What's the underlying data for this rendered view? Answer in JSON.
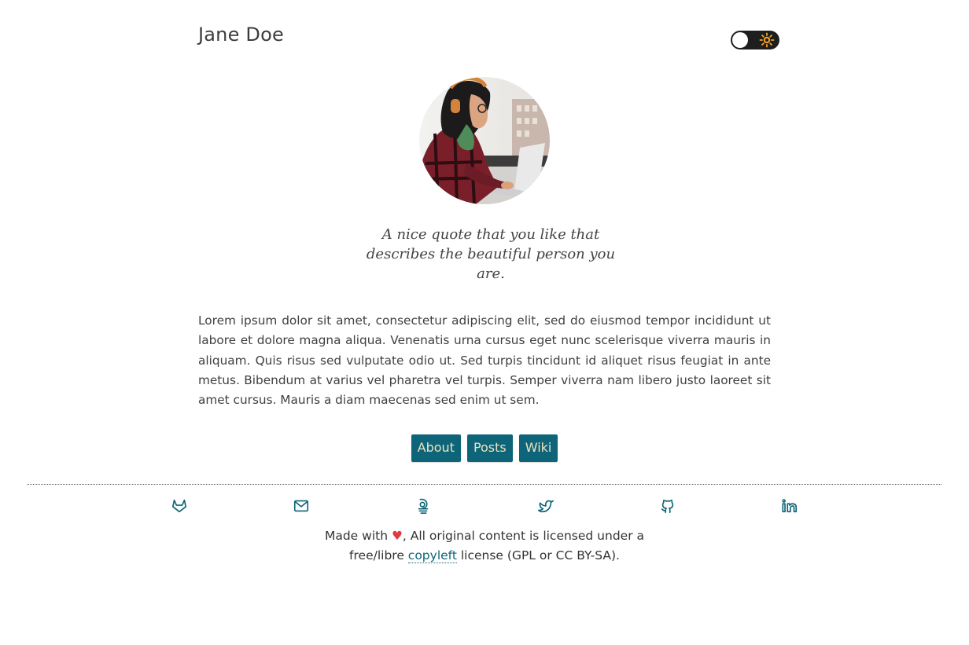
{
  "header": {
    "site_title": "Jane Doe",
    "theme_toggle": {
      "icon": "sun-icon",
      "state": "light"
    }
  },
  "profile": {
    "avatar_alt": "woman-with-headphones-using-laptop",
    "quote": "A nice quote that you like that describes the beautiful person you are.",
    "bio": "Lorem ipsum dolor sit amet, consectetur adipiscing elit, sed do eiusmod tempor incididunt ut labore et dolore magna aliqua. Venenatis urna cursus eget nunc scelerisque viverra mauris in aliquam. Quis risus sed vulputate odio ut. Sed turpis tincidunt id aliquet risus feugiat in ante metus. Bibendum at varius vel pharetra vel turpis. Semper viverra nam libero justo laoreet sit amet cursus. Mauris a diam maecenas sed enim ut sem."
  },
  "nav": {
    "about_label": "About",
    "posts_label": "Posts",
    "wiki_label": "Wiki"
  },
  "social": {
    "icons": [
      "gitlab-icon",
      "mail-icon",
      "keybase-icon",
      "twitter-icon",
      "github-icon",
      "linkedin-icon"
    ]
  },
  "footer": {
    "made_with": "Made with",
    "heart": "♥",
    "part1": ", All original content is licensed under a free/libre",
    "link": "copyleft",
    "part2": "license (GPL or CC BY-SA)."
  },
  "colors": {
    "accent": "#0e6478",
    "button_text": "#e9e4c2",
    "heart": "#e0393e",
    "sun": "#f5a623"
  }
}
